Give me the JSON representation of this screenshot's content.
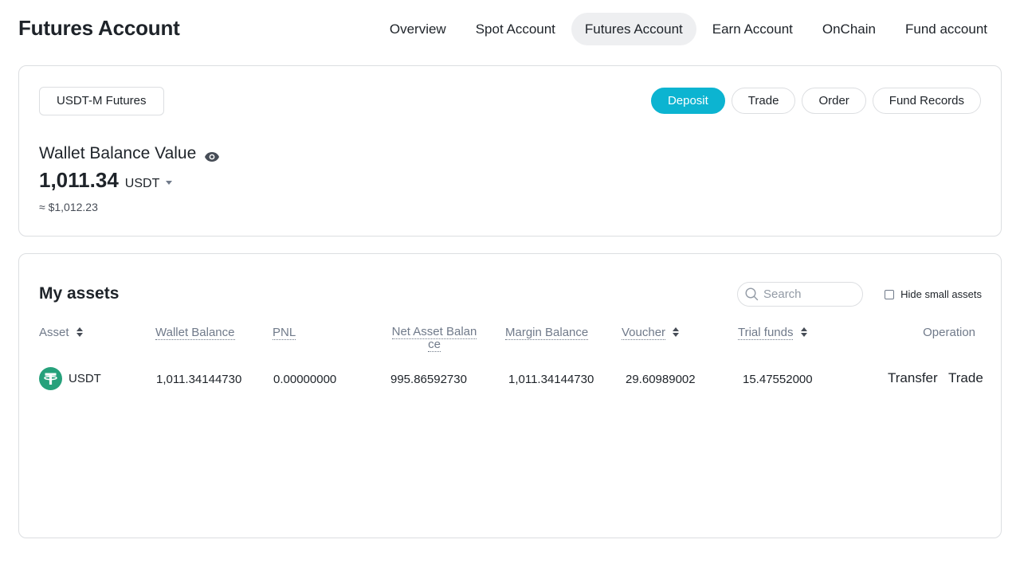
{
  "header": {
    "title": "Futures Account",
    "tabs": [
      {
        "label": "Overview",
        "active": false
      },
      {
        "label": "Spot Account",
        "active": false
      },
      {
        "label": "Futures Account",
        "active": true
      },
      {
        "label": "Earn Account",
        "active": false
      },
      {
        "label": "OnChain",
        "active": false
      },
      {
        "label": "Fund account",
        "active": false
      }
    ]
  },
  "balance": {
    "account_type": "USDT-M Futures",
    "actions": {
      "deposit": "Deposit",
      "trade": "Trade",
      "order": "Order",
      "fund_records": "Fund Records"
    },
    "label": "Wallet Balance Value",
    "amount": "1,011.34",
    "currency": "USDT",
    "approx": "≈ $1,012.23"
  },
  "assets": {
    "title": "My assets",
    "search_placeholder": "Search",
    "hide_small_label": "Hide small assets",
    "hide_small_checked": false,
    "columns": {
      "asset": "Asset",
      "wallet_balance": "Wallet Balance",
      "pnl": "PNL",
      "net_asset_balance": "Net Asset Balance",
      "margin_balance": "Margin Balance",
      "voucher": "Voucher",
      "trial_funds": "Trial funds",
      "operation": "Operation"
    },
    "rows": [
      {
        "asset": "USDT",
        "wallet_balance": "1,011.34144730",
        "pnl": "0.00000000",
        "net_asset_balance": "995.86592730",
        "margin_balance": "1,011.34144730",
        "voucher": "29.60989002",
        "trial_funds": "15.47552000",
        "operations": {
          "transfer": "Transfer",
          "trade": "Trade"
        }
      }
    ]
  },
  "colors": {
    "accent": "#0cb4d1",
    "tether": "#26a17b",
    "border": "#dcdee1",
    "muted": "#707a8a"
  },
  "icons": {
    "visibility": "eye-icon",
    "search": "search-icon",
    "sort": "sort-icon",
    "coin": "tether-icon"
  }
}
